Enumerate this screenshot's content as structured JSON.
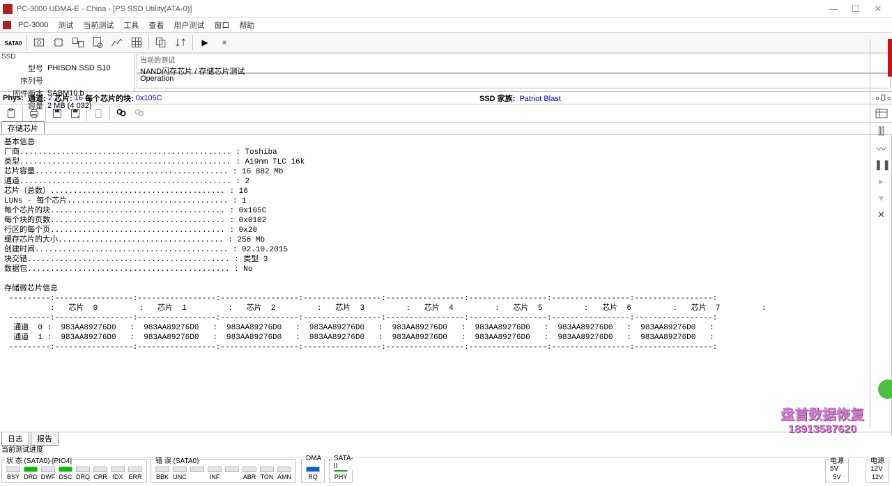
{
  "title": "PC-3000 UDMA-E - China - [PS SSD Utility(ATA-0)]",
  "menu": {
    "app": "PC-3000",
    "items": [
      "测试",
      "当前测试",
      "工具",
      "查看",
      "用户测试",
      "窗口",
      "帮助"
    ]
  },
  "info_left_header": "SSD",
  "info_left": {
    "k1": "型号",
    "v1": "PHISON SSD S10",
    "k2": "序列号",
    "v2": "",
    "k3": "固件版本",
    "v3": "SABM10.b",
    "k4": "容量",
    "v4": "2 MB (4 032)"
  },
  "info_right": {
    "box1_label": "当前的测试",
    "box1_value": "NAND闪存芯片 / 存储芯片测试",
    "box2_label": "Operation"
  },
  "phys": {
    "label": "Phys:",
    "ch_lbl": "通道:",
    "ch": "2",
    "chip_lbl": "芯片:",
    "chip": "16",
    "blk_lbl": "每个芯片的块:",
    "blk": "0x105C",
    "fam_lbl": "SSD 家族:",
    "fam": "Patriot Blast"
  },
  "tab_label": "存储芯片",
  "report_header": "基本信息",
  "report_labels": {
    "vendor": "厂商",
    "type": "类型",
    "capacity": "芯片容量",
    "channels": "通道",
    "chips_total": "芯片（总数）",
    "luns": "LUNs - 每个芯片",
    "blocks_per_chip": "每个芯片的块",
    "pages_per_block": "每个块的页数",
    "rows_per_page": "行区的每个页",
    "chip_data_size": "缓存芯片的大小",
    "create_time": "创建时间",
    "interleave": "块交错",
    "data_blk": "数据包"
  },
  "report_values": {
    "vendor": "Toshiba",
    "type": "A19nm TLC 16k",
    "capacity": "16 882 Mb",
    "channels": "2",
    "chips_total": "16",
    "luns": "1",
    "blocks_per_chip": "0x105С",
    "pages_per_block": "0x0102",
    "rows_per_page": "0x20",
    "chip_data_size": "256 Mb",
    "create_time": "02.10.2015",
    "interleave_label": "类型",
    "interleave": "3",
    "data_blk": "No"
  },
  "chip_table_header": "存储微芯片信息",
  "chip_cols": [
    "芯片  0",
    "芯片  1",
    "芯片  2",
    "芯片  3",
    "芯片  4",
    "芯片  5",
    "芯片  6",
    "芯片  7"
  ],
  "chip_row_labels": [
    "通道  0",
    "通道  1"
  ],
  "chip_id": "983AA89276D0",
  "bottom_tabs": [
    "日志",
    "报告"
  ],
  "progress_label": "当前测试进度",
  "status_group1": "状 态 (SATA0)-[PIO4]",
  "status_group2": "错 误 (SATA0)",
  "status_group3": "DMA",
  "status_group4": "SATA-II",
  "power1": "电源 5V",
  "power2": "电源 12V",
  "leds1": [
    "BSY",
    "DRD",
    "DWF",
    "DSC",
    "DRQ",
    "CRR",
    "IDX",
    "ERR"
  ],
  "leds1_on": [
    false,
    true,
    false,
    true,
    false,
    false,
    false,
    false
  ],
  "leds2": [
    "BBK",
    "UNC",
    "",
    "INF",
    "",
    "ABR",
    "TON",
    "AMN"
  ],
  "leds3": [
    "RQ"
  ],
  "leds4": [
    "PHY"
  ],
  "pled1": "5V",
  "pled2": "12V",
  "watermark": {
    "line1": "盘首数据恢复",
    "line2": "18913587620"
  },
  "rside_zero": "0"
}
